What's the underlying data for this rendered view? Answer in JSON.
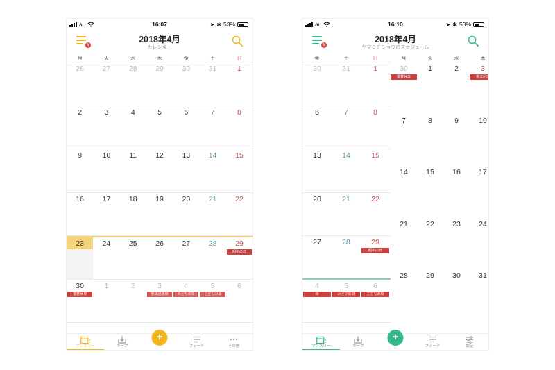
{
  "screens": [
    {
      "status": {
        "carrier": "au",
        "time": "16:07",
        "battery": "53%"
      },
      "header": {
        "title": "2018年4月",
        "subtitle": "カレンダー",
        "accent": "#f2b51b"
      },
      "weekdays": [
        "月",
        "火",
        "水",
        "木",
        "金",
        "土",
        "日"
      ],
      "weeks": [
        [
          {
            "d": "26",
            "out": true
          },
          {
            "d": "27",
            "out": true
          },
          {
            "d": "28",
            "out": true
          },
          {
            "d": "29",
            "out": true
          },
          {
            "d": "30",
            "out": true
          },
          {
            "d": "31",
            "out": true
          },
          {
            "d": "1"
          }
        ],
        [
          {
            "d": "2"
          },
          {
            "d": "3"
          },
          {
            "d": "4"
          },
          {
            "d": "5"
          },
          {
            "d": "6"
          },
          {
            "d": "7"
          },
          {
            "d": "8"
          }
        ],
        [
          {
            "d": "9"
          },
          {
            "d": "10"
          },
          {
            "d": "11"
          },
          {
            "d": "12"
          },
          {
            "d": "13"
          },
          {
            "d": "14"
          },
          {
            "d": "15"
          }
        ],
        [
          {
            "d": "16"
          },
          {
            "d": "17"
          },
          {
            "d": "18"
          },
          {
            "d": "19"
          },
          {
            "d": "20"
          },
          {
            "d": "21"
          },
          {
            "d": "22"
          }
        ],
        [
          {
            "d": "23",
            "today": true
          },
          {
            "d": "24"
          },
          {
            "d": "25"
          },
          {
            "d": "26"
          },
          {
            "d": "27"
          },
          {
            "d": "28"
          },
          {
            "d": "29",
            "ev": "昭和の日"
          }
        ],
        [
          {
            "d": "30",
            "ev": "振替休日"
          },
          {
            "d": "1",
            "out": true
          },
          {
            "d": "2",
            "out": true
          },
          {
            "d": "3",
            "out": true,
            "ev": "憲法記念日"
          },
          {
            "d": "4",
            "out": true,
            "ev": "みどりの日"
          },
          {
            "d": "5",
            "out": true,
            "ev": "こどもの日"
          },
          {
            "d": "6",
            "out": true
          }
        ]
      ],
      "tabs": [
        "マンスリー",
        "キープ",
        "",
        "フィード",
        "その他"
      ]
    },
    {
      "status": {
        "carrier": "au",
        "time": "16:10",
        "battery": "53%"
      },
      "header": {
        "title": "2018年4月",
        "subtitle": "ヤマミチショウのスケジュール",
        "accent": "#33b98a"
      },
      "left_weekdays": [
        "金",
        "土",
        "日"
      ],
      "left_weeks": [
        [
          {
            "d": "30",
            "out": true
          },
          {
            "d": "31",
            "out": true
          },
          {
            "d": "1",
            "sun": true
          }
        ],
        [
          {
            "d": "6"
          },
          {
            "d": "7",
            "sat": true
          },
          {
            "d": "8",
            "sun": true
          }
        ],
        [
          {
            "d": "13"
          },
          {
            "d": "14",
            "sat": true
          },
          {
            "d": "15",
            "sun": true
          }
        ],
        [
          {
            "d": "20"
          },
          {
            "d": "21",
            "sat": true
          },
          {
            "d": "22",
            "sun": true
          }
        ],
        [
          {
            "d": "27"
          },
          {
            "d": "28",
            "sat": true
          },
          {
            "d": "29",
            "sun": true,
            "ev": "昭和の日"
          }
        ],
        [
          {
            "d": "4",
            "out": true,
            "ev": "日"
          },
          {
            "d": "5",
            "out": true,
            "ev": "みどりの日"
          },
          {
            "d": "6",
            "out": true,
            "ev": "こどもの日"
          }
        ]
      ],
      "right_weekdays": [
        "月",
        "火",
        "水",
        "木"
      ],
      "right_columns": [
        {
          "days": [
            {
              "d": "30",
              "out": true,
              "ev": "振替休日"
            },
            {
              "d": "7"
            },
            {
              "d": "14"
            },
            {
              "d": "21"
            },
            {
              "d": "28"
            }
          ]
        },
        {
          "days": [
            {
              "d": "1"
            },
            {
              "d": "8"
            },
            {
              "d": "15"
            },
            {
              "d": "22"
            },
            {
              "d": "29"
            }
          ]
        },
        {
          "days": [
            {
              "d": "2"
            },
            {
              "d": "9"
            },
            {
              "d": "16"
            },
            {
              "d": "23"
            },
            {
              "d": "30"
            }
          ]
        },
        {
          "days": [
            {
              "d": "3",
              "sun": true,
              "ev": "憲法記念"
            },
            {
              "d": "10"
            },
            {
              "d": "17"
            },
            {
              "d": "24"
            },
            {
              "d": "31"
            }
          ]
        }
      ],
      "tabs": [
        "マンスリー",
        "キープ",
        "",
        "フィード",
        "設定"
      ]
    }
  ],
  "colors": {
    "holiday": "#c9403d",
    "saturday": "#5b9aa9",
    "sunday": "#c0504d"
  }
}
